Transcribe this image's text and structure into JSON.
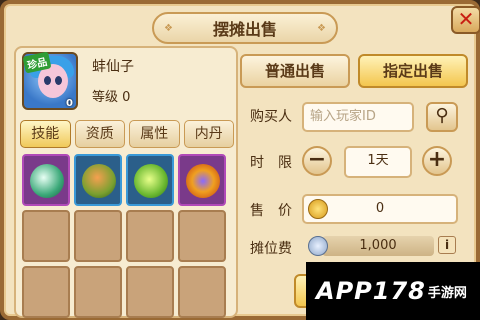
{
  "dialog": {
    "title": "摆摊出售",
    "close_icon": "close-icon"
  },
  "pet": {
    "name": "蚌仙子",
    "level_label": "等级 0",
    "rarity_badge": "珍品",
    "count": "0"
  },
  "tabs": [
    {
      "label": "技能",
      "active": true
    },
    {
      "label": "资质",
      "active": false
    },
    {
      "label": "属性",
      "active": false
    },
    {
      "label": "内丹",
      "active": false
    }
  ],
  "sell_modes": {
    "normal": "普通出售",
    "designated": "指定出售"
  },
  "buyer": {
    "label": "购买人",
    "placeholder": "输入玩家ID"
  },
  "duration": {
    "label": "时　限",
    "value": "1天"
  },
  "price": {
    "label": "售　价",
    "value": "0"
  },
  "fee": {
    "label": "摊位费",
    "value": "1,000"
  },
  "watermark": {
    "brand": "APP178",
    "sub": "手游网"
  },
  "colors": {
    "accent": "#f3c64e",
    "close": "#c81e12",
    "panel": "#f3e3bf"
  }
}
